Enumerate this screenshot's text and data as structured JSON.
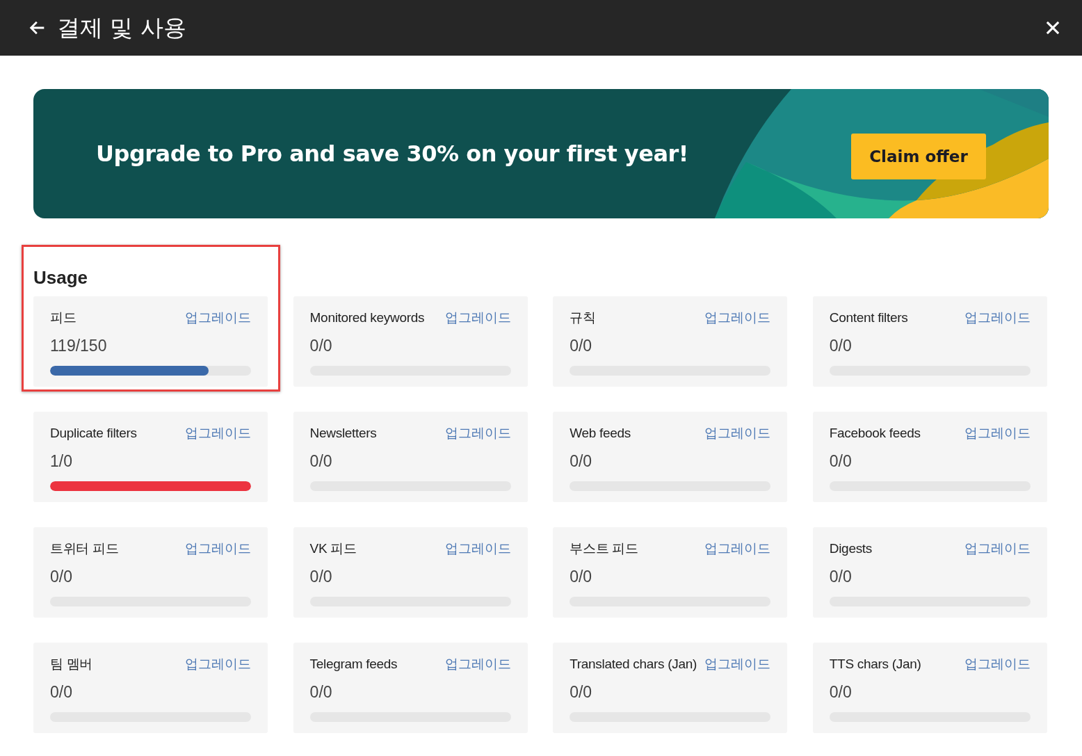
{
  "header": {
    "title": "결제 및 사용"
  },
  "banner": {
    "headline": "Upgrade to Pro and save 30% on your first year!",
    "button": "Claim offer"
  },
  "usage": {
    "title": "Usage",
    "highlighted": true,
    "cards": [
      {
        "name": "피드",
        "action": "업그레이드",
        "reading": "119/150",
        "level": 0.79,
        "color": "#3b69a9"
      },
      {
        "name": "Monitored keywords",
        "action": "업그레이드",
        "reading": "0/0"
      },
      {
        "name": "규칙",
        "action": "업그레이드",
        "reading": "0/0"
      },
      {
        "name": "Content filters",
        "action": "업그레이드",
        "reading": "0/0"
      },
      {
        "name": "Duplicate filters",
        "action": "업그레이드",
        "reading": "1/0",
        "level": 1,
        "color": "#ec3440"
      },
      {
        "name": "Newsletters",
        "action": "업그레이드",
        "reading": "0/0"
      },
      {
        "name": "Web feeds",
        "action": "업그레이드",
        "reading": "0/0"
      },
      {
        "name": "Facebook feeds",
        "action": "업그레이드",
        "reading": "0/0"
      },
      {
        "name": "트위터 피드",
        "action": "업그레이드",
        "reading": "0/0"
      },
      {
        "name": "VK 피드",
        "action": "업그레이드",
        "reading": "0/0"
      },
      {
        "name": "부스트 피드",
        "action": "업그레이드",
        "reading": "0/0"
      },
      {
        "name": "Digests",
        "action": "업그레이드",
        "reading": "0/0"
      },
      {
        "name": "팀 멤버",
        "action": "업그레이드",
        "reading": "0/0"
      },
      {
        "name": "Telegram feeds",
        "action": "업그레이드",
        "reading": "0/0"
      },
      {
        "name": "Translated chars (Jan)",
        "action": "업그레이드",
        "reading": "0/0"
      },
      {
        "name": "TTS chars (Jan)",
        "action": "업그레이드",
        "reading": "0/0"
      }
    ]
  }
}
